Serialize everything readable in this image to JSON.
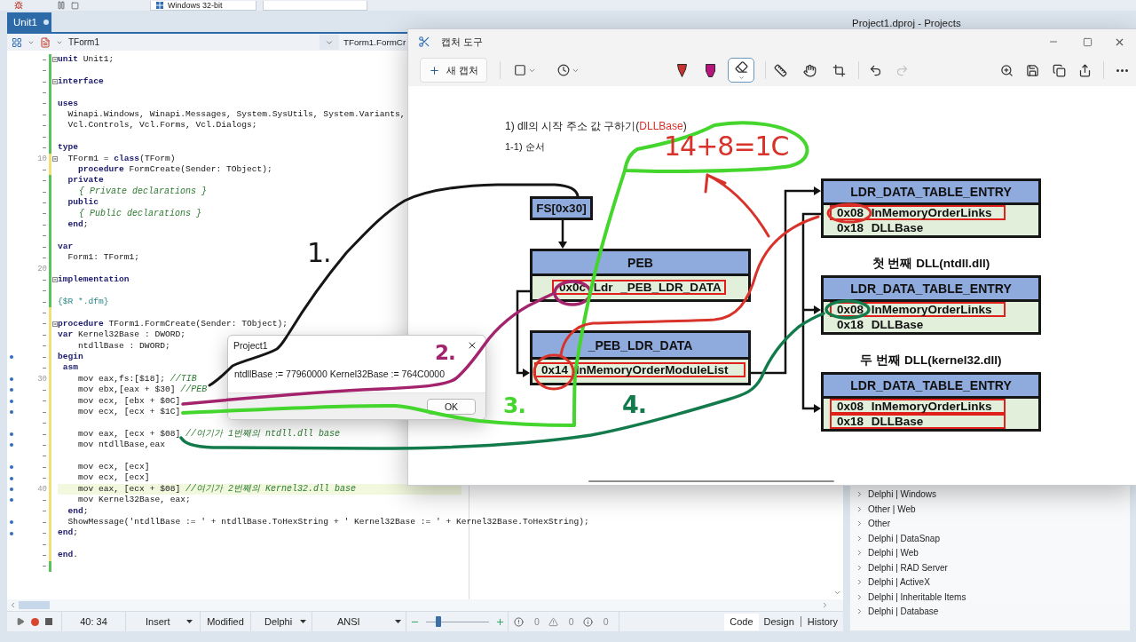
{
  "ide_toolbar": {
    "platform": "Windows 32-bit"
  },
  "editor": {
    "tabs": [
      {
        "label": "Unit1",
        "selected": true,
        "modified": true
      }
    ],
    "class_selector": "TForm1",
    "method_selector": "TForm1.FormCr",
    "lines": [
      {
        "tokens": [
          {
            "kind": "keyword",
            "text": "unit"
          },
          {
            "kind": "plain",
            "text": " Unit1;"
          }
        ],
        "fold": true,
        "modified": false,
        "executable": false,
        "current": false
      },
      {
        "fold": false,
        "modified": false,
        "executable": false,
        "current": false
      },
      {
        "tokens": [
          {
            "kind": "keyword",
            "text": "interface"
          }
        ],
        "fold": true,
        "modified": false,
        "executable": false,
        "current": false
      },
      {
        "fold": false,
        "modified": false,
        "executable": false,
        "current": false
      },
      {
        "tokens": [
          {
            "kind": "keyword",
            "text": "uses"
          }
        ],
        "fold": false,
        "modified": false,
        "executable": false,
        "current": false
      },
      {
        "tokens": [
          {
            "kind": "plain",
            "text": "  Winapi.Windows, Winapi.Messages, System.SysUtils, System.Variants,"
          }
        ],
        "fold": false,
        "modified": false,
        "executable": false,
        "current": false
      },
      {
        "tokens": [
          {
            "kind": "plain",
            "text": "  Vcl.Controls, Vcl.Forms, Vcl.Dialogs;"
          }
        ],
        "fold": false,
        "modified": false,
        "executable": false,
        "current": false
      },
      {
        "fold": false,
        "modified": false,
        "executable": false,
        "current": false
      },
      {
        "tokens": [
          {
            "kind": "keyword",
            "text": "type"
          }
        ],
        "fold": false,
        "modified": false,
        "executable": false,
        "current": false
      },
      {
        "number": "10",
        "tokens": [
          {
            "kind": "plain",
            "text": "  TForm1 = "
          },
          {
            "kind": "keyword",
            "text": "class"
          },
          {
            "kind": "plain",
            "text": "(TForm)"
          }
        ],
        "fold": true,
        "modified": true,
        "executable": false,
        "current": false
      },
      {
        "tokens": [
          {
            "kind": "keyword",
            "text": "    procedure"
          },
          {
            "kind": "plain",
            "text": " FormCreate(Sender: TObject);"
          }
        ],
        "fold": false,
        "modified": true,
        "executable": false,
        "current": false
      },
      {
        "tokens": [
          {
            "kind": "keyword",
            "text": "  private"
          }
        ],
        "fold": false,
        "modified": false,
        "executable": false,
        "current": false
      },
      {
        "tokens": [
          {
            "kind": "comment",
            "text": "    { Private declarations }"
          }
        ],
        "fold": false,
        "modified": false,
        "executable": false,
        "current": false
      },
      {
        "tokens": [
          {
            "kind": "keyword",
            "text": "  public"
          }
        ],
        "fold": false,
        "modified": false,
        "executable": false,
        "current": false
      },
      {
        "tokens": [
          {
            "kind": "comment",
            "text": "    { Public declarations }"
          }
        ],
        "fold": false,
        "modified": false,
        "executable": false,
        "current": false
      },
      {
        "tokens": [
          {
            "kind": "keyword",
            "text": "  end"
          },
          {
            "kind": "plain",
            "text": ";"
          }
        ],
        "fold": false,
        "modified": false,
        "executable": false,
        "current": false
      },
      {
        "fold": false,
        "modified": false,
        "executable": false,
        "current": false
      },
      {
        "tokens": [
          {
            "kind": "keyword",
            "text": "var"
          }
        ],
        "fold": false,
        "modified": false,
        "executable": false,
        "current": false
      },
      {
        "tokens": [
          {
            "kind": "plain",
            "text": "  Form1: TForm1;"
          }
        ],
        "fold": false,
        "modified": false,
        "executable": false,
        "current": false
      },
      {
        "number": "20",
        "fold": false,
        "modified": false,
        "executable": false,
        "current": false
      },
      {
        "tokens": [
          {
            "kind": "keyword",
            "text": "implementation"
          }
        ],
        "fold": true,
        "modified": false,
        "executable": false,
        "current": false
      },
      {
        "fold": false,
        "modified": false,
        "executable": false,
        "current": false
      },
      {
        "tokens": [
          {
            "kind": "directive",
            "text": "{$R *.dfm}"
          }
        ],
        "fold": false,
        "modified": false,
        "executable": false,
        "current": false
      },
      {
        "fold": false,
        "modified": true,
        "executable": false,
        "current": false
      },
      {
        "tokens": [
          {
            "kind": "keyword",
            "text": "procedure"
          },
          {
            "kind": "plain",
            "text": " TForm1.FormCreate(Sender: TObject);"
          }
        ],
        "fold": true,
        "modified": true,
        "executable": false,
        "current": false
      },
      {
        "tokens": [
          {
            "kind": "keyword",
            "text": "var"
          },
          {
            "kind": "plain",
            "text": " Kernel32Base : DWORD;"
          }
        ],
        "fold": false,
        "modified": true,
        "executable": false,
        "current": false
      },
      {
        "tokens": [
          {
            "kind": "plain",
            "text": "    ntdllBase : DWORD;"
          }
        ],
        "fold": false,
        "modified": true,
        "executable": false,
        "current": false
      },
      {
        "tokens": [
          {
            "kind": "keyword",
            "text": "begin"
          }
        ],
        "fold": false,
        "modified": true,
        "executable": true,
        "current": false
      },
      {
        "tokens": [
          {
            "kind": "keyword",
            "text": " asm"
          }
        ],
        "fold": false,
        "modified": true,
        "executable": false,
        "current": false
      },
      {
        "number": "30",
        "tokens": [
          {
            "kind": "plain",
            "text": "    mov eax,fs:[$18]; "
          },
          {
            "kind": "comment",
            "text": "//TIB"
          }
        ],
        "fold": false,
        "modified": true,
        "executable": true,
        "current": false
      },
      {
        "tokens": [
          {
            "kind": "plain",
            "text": "    mov ebx,[eax + $30] "
          },
          {
            "kind": "comment",
            "text": "//PEB"
          }
        ],
        "fold": false,
        "modified": true,
        "executable": true,
        "current": false
      },
      {
        "tokens": [
          {
            "kind": "plain",
            "text": "    mov ecx, [ebx + $0C]"
          }
        ],
        "fold": false,
        "modified": true,
        "executable": true,
        "current": false
      },
      {
        "tokens": [
          {
            "kind": "plain",
            "text": "    mov ecx, [ecx + $1C]"
          }
        ],
        "fold": false,
        "modified": true,
        "executable": true,
        "current": false
      },
      {
        "fold": false,
        "modified": true,
        "executable": false,
        "current": false
      },
      {
        "tokens": [
          {
            "kind": "plain",
            "text": "    mov eax, [ecx + $08] "
          },
          {
            "kind": "comment",
            "text": "//여기가 1번째의 ntdll.dll base"
          }
        ],
        "fold": false,
        "modified": true,
        "executable": true,
        "current": false
      },
      {
        "tokens": [
          {
            "kind": "plain",
            "text": "    mov ntdllBase,eax"
          }
        ],
        "fold": false,
        "modified": true,
        "executable": true,
        "current": false
      },
      {
        "fold": false,
        "modified": true,
        "executable": false,
        "current": false
      },
      {
        "tokens": [
          {
            "kind": "plain",
            "text": "    mov ecx, [ecx]"
          }
        ],
        "fold": false,
        "modified": true,
        "executable": true,
        "current": false
      },
      {
        "tokens": [
          {
            "kind": "plain",
            "text": "    mov ecx, [ecx]"
          }
        ],
        "fold": false,
        "modified": true,
        "executable": true,
        "current": false
      },
      {
        "number": "40",
        "tokens": [
          {
            "kind": "plain",
            "text": "    mov eax, [ecx + $08] "
          },
          {
            "kind": "comment",
            "text": "//여기가 2번째의 Kernel32.dll base"
          }
        ],
        "fold": false,
        "modified": true,
        "executable": true,
        "current": true
      },
      {
        "tokens": [
          {
            "kind": "plain",
            "text": "    mov Kernel32Base, eax;"
          }
        ],
        "fold": false,
        "modified": true,
        "executable": true,
        "current": false
      },
      {
        "tokens": [
          {
            "kind": "keyword",
            "text": "  end"
          },
          {
            "kind": "plain",
            "text": ";"
          }
        ],
        "fold": false,
        "modified": true,
        "executable": false,
        "current": false
      },
      {
        "tokens": [
          {
            "kind": "plain",
            "text": "  ShowMessage('ntdllBase := ' + ntdllBase.ToHexString + ' Kernel32Base := ' + Kernel32Base.ToHexString);"
          }
        ],
        "fold": false,
        "modified": true,
        "executable": true,
        "current": false
      },
      {
        "tokens": [
          {
            "kind": "keyword",
            "text": "end"
          },
          {
            "kind": "plain",
            "text": ";"
          }
        ],
        "fold": false,
        "modified": true,
        "executable": true,
        "current": false
      },
      {
        "fold": false,
        "modified": true,
        "executable": false,
        "current": false
      },
      {
        "tokens": [
          {
            "kind": "keyword",
            "text": "end"
          },
          {
            "kind": "plain",
            "text": "."
          }
        ],
        "fold": false,
        "modified": true,
        "executable": false,
        "current": false
      },
      {
        "fold": false,
        "modified": false,
        "executable": false,
        "current": false
      }
    ]
  },
  "status_bar": {
    "position": "40: 34",
    "insert_mode": "Insert",
    "state": "Modified",
    "language": "Delphi",
    "encoding": "ANSI",
    "zoom": {
      "level": 0.18
    },
    "counts": [
      {
        "kind": "error",
        "value": "0"
      },
      {
        "kind": "warning",
        "value": "0"
      },
      {
        "kind": "info",
        "value": "0"
      }
    ],
    "views": [
      {
        "label": "Code",
        "selected": true
      },
      {
        "label": "Design",
        "selected": false
      },
      {
        "label": "History",
        "selected": false
      }
    ]
  },
  "project_panel": {
    "title": "Project1.dproj - Projects",
    "items": [
      {
        "label": "Delphi | Windows",
        "expanded": false
      },
      {
        "label": "Other | Web",
        "expanded": false
      },
      {
        "label": "Other",
        "expanded": false
      },
      {
        "label": "Delphi | DataSnap",
        "expanded": false
      },
      {
        "label": "Delphi | Web",
        "expanded": false
      },
      {
        "label": "Delphi | RAD Server",
        "expanded": false
      },
      {
        "label": "Delphi | ActiveX",
        "expanded": false
      },
      {
        "label": "Delphi | Inheritable Items",
        "expanded": false
      },
      {
        "label": "Delphi | Database",
        "expanded": false
      }
    ]
  },
  "snip_tool": {
    "title": "캡처 도구",
    "new_capture": "새 캡처",
    "tools": [
      {
        "kind": "pen",
        "color": "#c8322d",
        "selected": false
      },
      {
        "kind": "highlighter",
        "color": "#b5157c",
        "selected": false
      },
      {
        "kind": "eraser",
        "selected": true
      }
    ],
    "history": [
      {
        "kind": "undo",
        "disabled": false
      },
      {
        "kind": "redo",
        "disabled": true
      }
    ],
    "diagram": {
      "heading": [
        {
          "text": "1) dll의 시작 주소 값 구하기(",
          "highlight": false
        },
        {
          "text": "DLLBase",
          "highlight": true
        },
        {
          "text": ")",
          "highlight": false
        }
      ],
      "subheading": "1-1) 순서",
      "segment_register": "FS[0x30]",
      "structs": [
        {
          "title": "PEB",
          "fields": [
            {
              "text": "0x0c Ldr _PEB_LDR_DATA",
              "highlighted": true
            }
          ]
        },
        {
          "title": "_PEB_LDR_DATA",
          "fields": [
            {
              "text": "0x14 InMemoryOrderModuleList",
              "highlighted": true
            }
          ]
        }
      ],
      "entries": [
        {
          "title": "LDR_DATA_TABLE_ENTRY",
          "fields": [
            {
              "text": "0x08 InMemoryOrderLinks",
              "highlighted": true
            },
            {
              "text": "0x18 DLLBase",
              "highlighted": false
            }
          ]
        },
        {
          "caption": "첫 번째 DLL(ntdll.dll)",
          "title": "LDR_DATA_TABLE_ENTRY",
          "fields": [
            {
              "text": "0x08 InMemoryOrderLinks",
              "highlighted": true
            },
            {
              "text": "0x18 DLLBase",
              "highlighted": false
            }
          ]
        },
        {
          "caption": "두 번째 DLL(kernel32.dll)",
          "title": "LDR_DATA_TABLE_ENTRY",
          "fields": [
            {
              "text": "0x08 InMemoryOrderLinks",
              "highlighted": true
            },
            {
              "text": "0x18 DLLBase",
              "highlighted": true
            }
          ]
        }
      ]
    }
  },
  "dialog": {
    "title": "Project1",
    "message": "ntdllBase := 77960000 Kernel32Base := 764C0000",
    "button": "OK"
  },
  "annotations": [
    {
      "label": "1.",
      "color": "#161616"
    },
    {
      "label": "2.",
      "color": "#a3246c"
    },
    {
      "label": "3.",
      "color": "#45d62e"
    },
    {
      "label": "4.",
      "color": "#137a4c"
    },
    {
      "label": "14+8=1C",
      "color": "#d8332a"
    }
  ]
}
